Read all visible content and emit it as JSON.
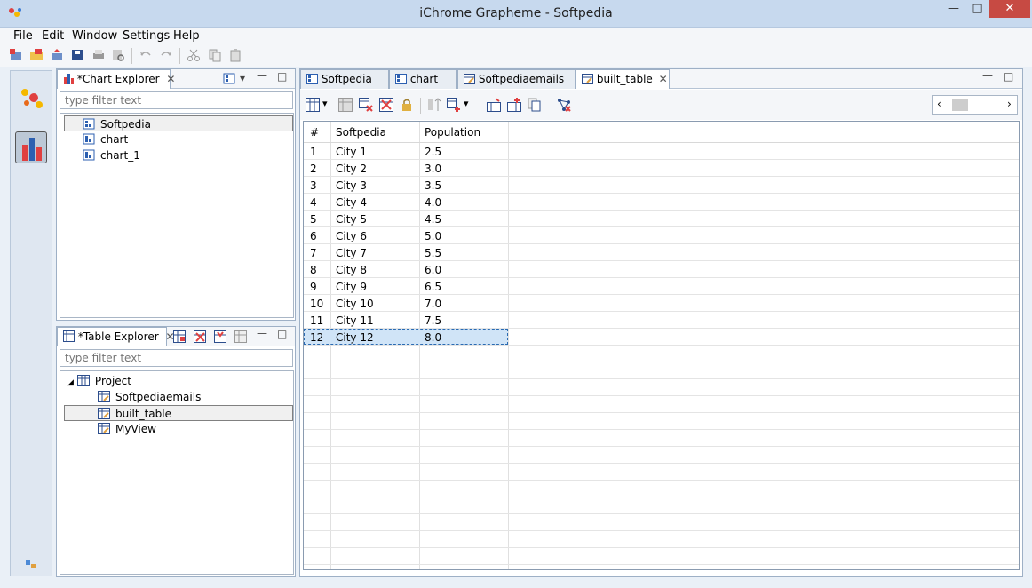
{
  "window": {
    "title": "iChrome Grapheme - Softpedia",
    "minimize": "—",
    "maximize": "□",
    "close": "✕"
  },
  "menu": [
    "File",
    "Edit",
    "Window",
    "Settings",
    "Help"
  ],
  "chart_explorer": {
    "tab_label": "*Chart Explorer",
    "filter_placeholder": "type filter text",
    "items": [
      "Softpedia",
      "chart",
      "chart_1"
    ]
  },
  "table_explorer": {
    "tab_label": "*Table Explorer",
    "filter_placeholder": "type filter text",
    "project": "Project",
    "items": [
      "Softpediaemails",
      "built_table",
      "MyView"
    ]
  },
  "editor": {
    "tabs": [
      "Softpedia",
      "chart",
      "Softpediaemails",
      "built_table"
    ],
    "columns": [
      "#",
      "Softpedia",
      "Population"
    ],
    "rows": [
      [
        "1",
        "City 1",
        "2.5"
      ],
      [
        "2",
        "City 2",
        "3.0"
      ],
      [
        "3",
        "City 3",
        "3.5"
      ],
      [
        "4",
        "City 4",
        "4.0"
      ],
      [
        "5",
        "City 5",
        "4.5"
      ],
      [
        "6",
        "City 6",
        "5.0"
      ],
      [
        "7",
        "City 7",
        "5.5"
      ],
      [
        "8",
        "City 8",
        "6.0"
      ],
      [
        "9",
        "City 9",
        "6.5"
      ],
      [
        "10",
        "City 10",
        "7.0"
      ],
      [
        "11",
        "City 11",
        "7.5"
      ],
      [
        "12",
        "City 12",
        "8.0"
      ]
    ],
    "selected_row": 12
  },
  "colors": {
    "accent": "#2b6bb2",
    "close_button": "#c74a43",
    "selection": "#d0e4f7"
  }
}
